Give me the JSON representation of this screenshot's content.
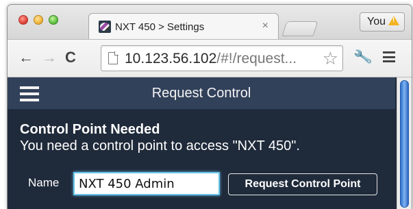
{
  "browser": {
    "tab": {
      "title": "NXT 450 > Settings",
      "close_glyph": "×",
      "icon": "nxt-logo-icon"
    },
    "profile": {
      "label": "You",
      "icon": "warning-icon"
    },
    "toolbar": {
      "back_glyph": "←",
      "forward_glyph": "→",
      "reload_glyph": "C",
      "url_host": "10.123.56.102",
      "url_path": "/#!/request...",
      "star_glyph": "☆",
      "wrench_glyph": "🔧"
    }
  },
  "app": {
    "header": {
      "title": "Request Control"
    },
    "notice": {
      "heading": "Control Point Needed",
      "message": "You need a control point to access \"NXT 450\"."
    },
    "form": {
      "name_label": "Name",
      "name_value": "NXT 450 Admin",
      "button_label": "Request Control Point"
    }
  },
  "colors": {
    "header_bg": "#32415a",
    "page_bg": "#1f2a3a",
    "input_focus": "#69c3e8"
  }
}
